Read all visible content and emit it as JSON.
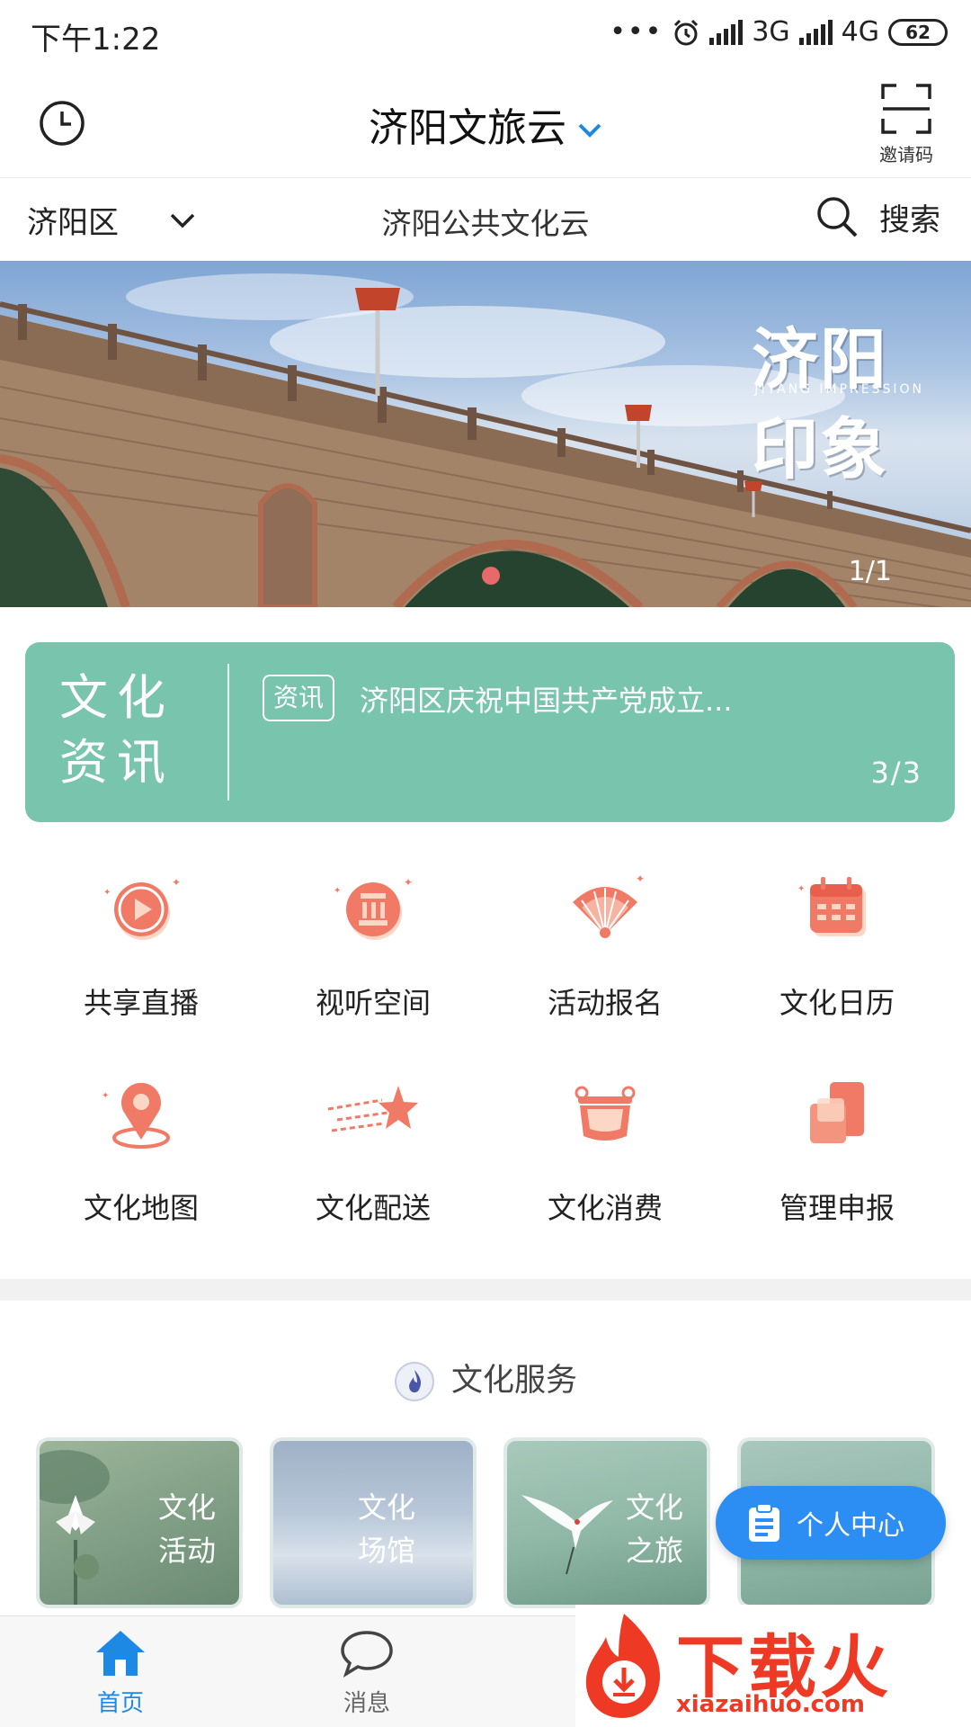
{
  "status_bar": {
    "time": "下午1:22",
    "network1": "3G",
    "network2": "4G",
    "battery": "62"
  },
  "header": {
    "title": "济阳文旅云",
    "invite_label": "邀请码"
  },
  "location": {
    "district": "济阳区",
    "center_title": "济阳公共文化云",
    "search_label": "搜索"
  },
  "banner": {
    "title_line1": "济阳",
    "title_line2": "印象",
    "subtitle": "JIYANG IMPRESSION",
    "counter": "1/1"
  },
  "news": {
    "logo_line1": "文化",
    "logo_line2": "资讯",
    "tag": "资讯",
    "headline": "济阳区庆祝中国共产党成立...",
    "pager": "3/3"
  },
  "quick_menu": [
    {
      "label": "共享直播",
      "icon": "play-icon"
    },
    {
      "label": "视听空间",
      "icon": "audio-space-icon"
    },
    {
      "label": "活动报名",
      "icon": "fan-icon"
    },
    {
      "label": "文化日历",
      "icon": "calendar-icon"
    },
    {
      "label": "文化地图",
      "icon": "map-pin-icon"
    },
    {
      "label": "文化配送",
      "icon": "shooting-star-icon"
    },
    {
      "label": "文化消费",
      "icon": "bowl-icon"
    },
    {
      "label": "管理申报",
      "icon": "documents-icon"
    }
  ],
  "service": {
    "title": "文化服务",
    "cards": [
      {
        "line1": "文化",
        "line2": "活动"
      },
      {
        "line1": "文化",
        "line2": "场馆"
      },
      {
        "line1": "文化",
        "line2": "之旅"
      }
    ]
  },
  "fab_label": "个人中心",
  "tabs": [
    {
      "label": "首页",
      "active": true
    },
    {
      "label": "消息",
      "active": false
    }
  ],
  "watermark": {
    "big": "下载火",
    "small": "xiazaihuo.com"
  },
  "colors": {
    "accent": "#1e88e5",
    "news_bg": "#79c4ad",
    "icon_coral": "#f07a66",
    "icon_light": "#fcd7c6"
  }
}
